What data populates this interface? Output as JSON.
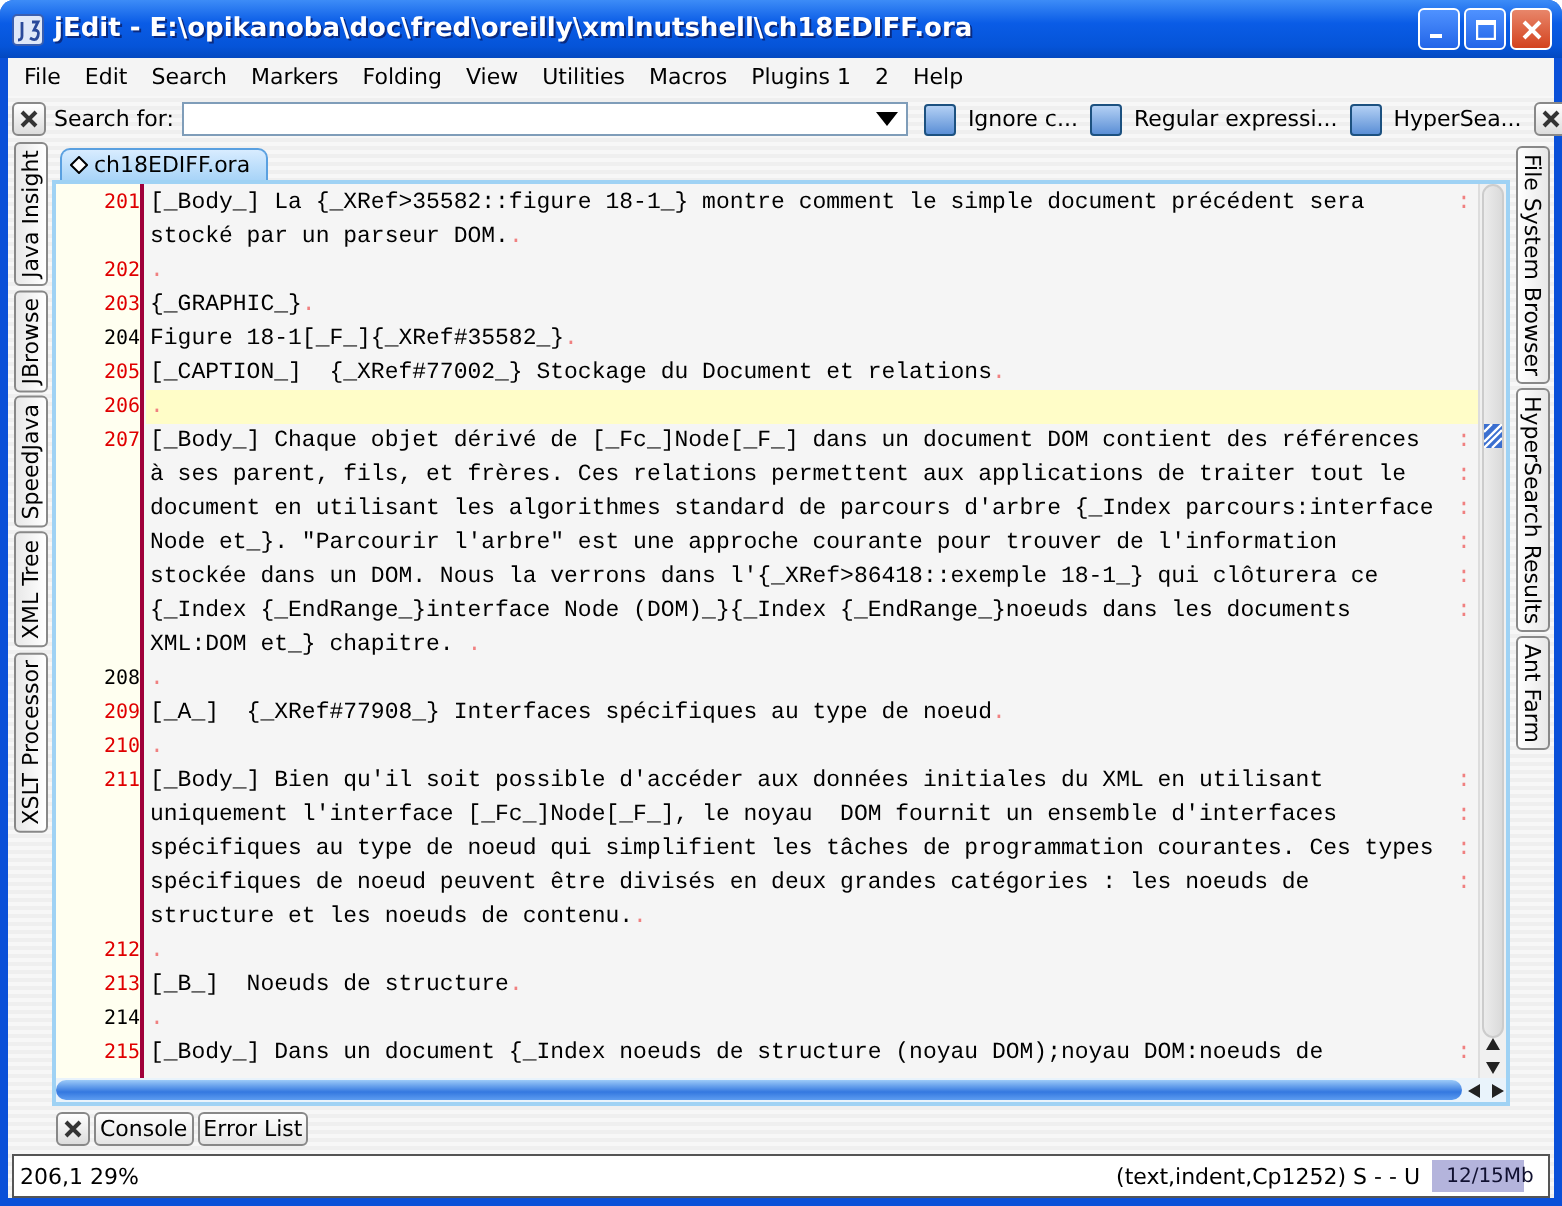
{
  "window": {
    "title": "jEdit - E:\\opikanoba\\doc\\fred\\oreilly\\xmlnutshell\\ch18EDIFF.ora"
  },
  "menu": [
    "File",
    "Edit",
    "Search",
    "Markers",
    "Folding",
    "View",
    "Utilities",
    "Macros",
    "Plugins 1",
    "2",
    "Help"
  ],
  "search_bar": {
    "label": "Search for:",
    "options": [
      {
        "label": "Ignore c...",
        "checked": false
      },
      {
        "label": "Regular expressi...",
        "checked": false
      },
      {
        "label": "HyperSea...",
        "checked": false
      }
    ]
  },
  "left_dock": [
    "Java Insight",
    "JBrowse",
    "SpeedJava",
    "XML Tree",
    "XSLT Processor"
  ],
  "right_dock": [
    "File System Browser",
    "HyperSearch Results",
    "Ant Farm"
  ],
  "buffer_tabs": [
    {
      "label": "ch18EDIFF.ora",
      "selected": true
    }
  ],
  "editor": {
    "wrap_marker": ":",
    "eol_marker": ".",
    "lines": [
      {
        "number": "201",
        "highlight": true,
        "current": false,
        "rows": [
          "[_Body_] La {_XRef>35582::figure 18-1_} montre comment le simple document précédent sera",
          "stocké par un parseur DOM."
        ]
      },
      {
        "number": "202",
        "highlight": true,
        "current": false,
        "rows": [
          ""
        ]
      },
      {
        "number": "203",
        "highlight": true,
        "current": false,
        "rows": [
          "{_GRAPHIC_}"
        ]
      },
      {
        "number": "204",
        "highlight": false,
        "current": false,
        "rows": [
          "Figure 18-1[_F_]{_XRef#35582_}"
        ]
      },
      {
        "number": "205",
        "highlight": true,
        "current": false,
        "rows": [
          "[_CAPTION_]  {_XRef#77002_} Stockage du Document et relations"
        ]
      },
      {
        "number": "206",
        "highlight": true,
        "current": true,
        "rows": [
          ""
        ]
      },
      {
        "number": "207",
        "highlight": true,
        "current": false,
        "rows": [
          "[_Body_] Chaque objet dérivé de [_Fc_]Node[_F_] dans un document DOM contient des références",
          "à ses parent, fils, et frères. Ces relations permettent aux applications de traiter tout le",
          "document en utilisant les algorithmes standard de parcours d'arbre {_Index parcours:interface",
          "Node et_}. \"Parcourir l'arbre\" est une approche courante pour trouver de l'information",
          "stockée dans un DOM. Nous la verrons dans l'{_XRef>86418::exemple 18-1_} qui clôturera ce",
          "{_Index {_EndRange_}interface Node (DOM)_}{_Index {_EndRange_}noeuds dans les documents",
          "XML:DOM et_} chapitre. "
        ]
      },
      {
        "number": "208",
        "highlight": false,
        "current": false,
        "rows": [
          ""
        ]
      },
      {
        "number": "209",
        "highlight": true,
        "current": false,
        "rows": [
          "[_A_]  {_XRef#77908_} Interfaces spécifiques au type de noeud"
        ]
      },
      {
        "number": "210",
        "highlight": true,
        "current": false,
        "rows": [
          ""
        ]
      },
      {
        "number": "211",
        "highlight": true,
        "current": false,
        "rows": [
          "[_Body_] Bien qu'il soit possible d'accéder aux données initiales du XML en utilisant",
          "uniquement l'interface [_Fc_]Node[_F_], le noyau  DOM fournit un ensemble d'interfaces",
          "spécifiques au type de noeud qui simplifient les tâches de programmation courantes. Ces types",
          "spécifiques de noeud peuvent être divisés en deux grandes catégories : les noeuds de",
          "structure et les noeuds de contenu."
        ]
      },
      {
        "number": "212",
        "highlight": true,
        "current": false,
        "rows": [
          ""
        ]
      },
      {
        "number": "213",
        "highlight": true,
        "current": false,
        "rows": [
          "[_B_]  Noeuds de structure"
        ]
      },
      {
        "number": "214",
        "highlight": false,
        "current": false,
        "rows": [
          ""
        ]
      },
      {
        "number": "215",
        "highlight": true,
        "current": false,
        "rows": [
          "[_Body_] Dans un document {_Index noeuds de structure (noyau DOM);noyau DOM:noeuds de"
        ]
      }
    ]
  },
  "bottom_dock": [
    "Console",
    "Error List"
  ],
  "status_bar": {
    "position": "206,1 29%",
    "mode": "(text,indent,Cp1252) S - - U",
    "memory": {
      "reading": "12/15Mb",
      "level": 0.8
    }
  }
}
